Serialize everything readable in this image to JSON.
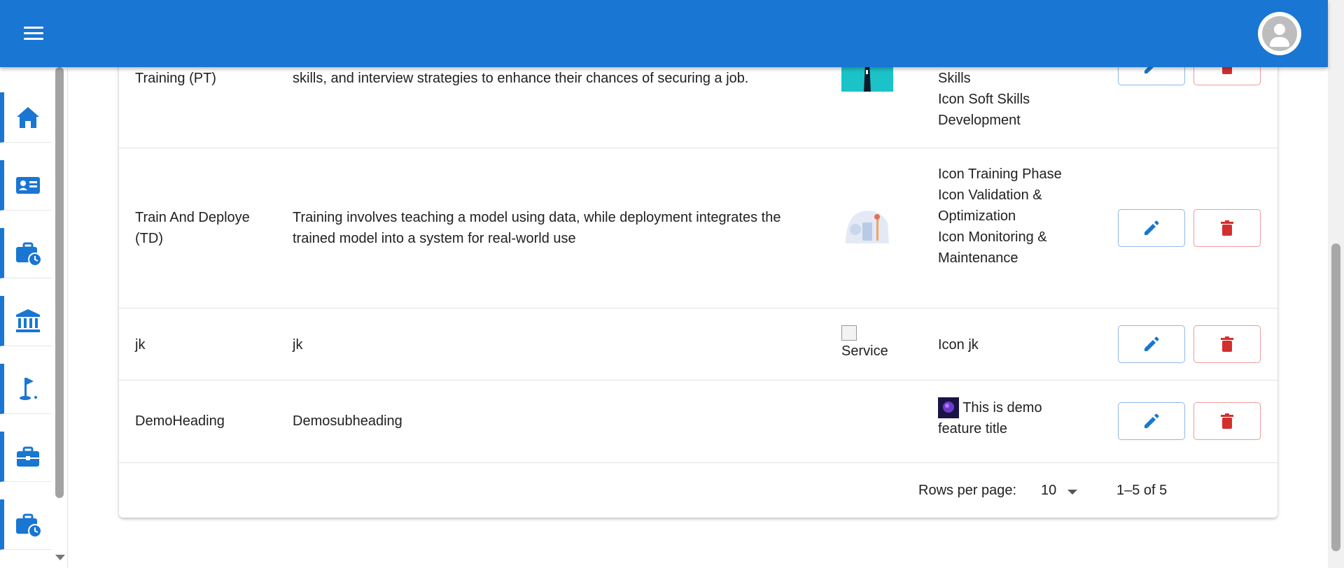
{
  "header": {
    "menu_icon": "hamburger-menu-icon",
    "avatar_icon": "account-avatar-icon",
    "accent": "#1976d2"
  },
  "sidebar": {
    "items": [
      {
        "icon": "home-icon"
      },
      {
        "icon": "id-card-icon"
      },
      {
        "icon": "briefcase-clock-icon"
      },
      {
        "icon": "bank-icon"
      },
      {
        "icon": "golf-flag-icon"
      },
      {
        "icon": "briefcase-icon"
      },
      {
        "icon": "briefcase-clock-icon"
      }
    ]
  },
  "table": {
    "rows": [
      {
        "title": "Training (PT)",
        "description": "skills, and interview strategies to enhance their chances of securing a job.",
        "image_alt": "",
        "features": [
          "Skills",
          "Icon Soft Skills Development"
        ]
      },
      {
        "title": "Train And Deploye (TD)",
        "description": "Training involves teaching a model using data, while deployment integrates the trained model into a system for real-world use",
        "image_alt": "",
        "features": [
          "Icon Training Phase",
          "Icon Validation & Optimization",
          "Icon Monitoring & Maintenance"
        ]
      },
      {
        "title": "jk",
        "description": "jk",
        "image_alt": "Service",
        "features": [
          "Icon jk"
        ]
      },
      {
        "title": "DemoHeading",
        "description": "Demosubheading",
        "image_alt": "",
        "features": [
          "This is demo feature title"
        ]
      }
    ]
  },
  "pagination": {
    "rows_per_page_label": "Rows per page:",
    "rows_per_page_value": "10",
    "range_text": "1–5 of 5"
  },
  "colors": {
    "edit": "#1976d2",
    "delete": "#d32f2f"
  }
}
